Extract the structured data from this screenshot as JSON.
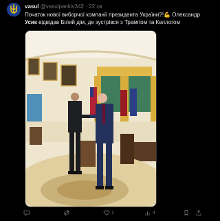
{
  "post": {
    "author": "vasul",
    "handle": "@vasulpankiv342",
    "separator": "·",
    "time": "22 хв",
    "text_line1": "Початок нової виборчої компанії президента України?!💪 Олександр",
    "text_bold": "Усик",
    "text_line2_rest": " відвідав Білий дім, де зустрівся з Трампом та Келлогом"
  },
  "actions": {
    "replies": "",
    "reposts": "",
    "likes": "1",
    "views": "4"
  },
  "icons": [
    "avatar-trident",
    "reply-icon",
    "repost-icon",
    "like-icon",
    "views-icon",
    "bookmark-icon",
    "share-icon"
  ],
  "colors": {
    "background": "#000000",
    "text": "#e7e9ea",
    "muted": "#71767b",
    "avatar": "#1c3f8c"
  }
}
